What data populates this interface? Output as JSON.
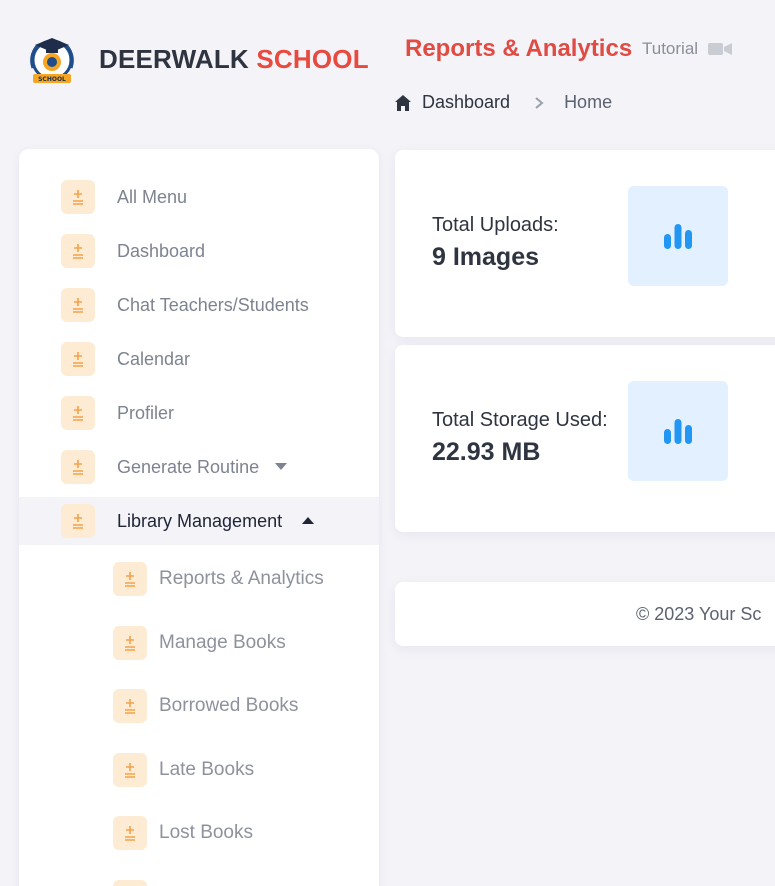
{
  "brand": {
    "part1": "DEERWALK",
    "part2": "SCHOOL",
    "logo_text": "SCHOOL"
  },
  "header": {
    "title": "Reports & Analytics",
    "tutorial_label": "Tutorial",
    "breadcrumb": {
      "dashboard": "Dashboard",
      "home": "Home"
    }
  },
  "sidebar": {
    "items": [
      {
        "label": "All Menu"
      },
      {
        "label": "Dashboard"
      },
      {
        "label": "Chat Teachers/Students"
      },
      {
        "label": "Calendar"
      },
      {
        "label": "Profiler"
      },
      {
        "label": "Generate Routine"
      },
      {
        "label": "Library Management"
      }
    ],
    "library_sub_items": [
      {
        "label": "Reports & Analytics"
      },
      {
        "label": "Manage Books"
      },
      {
        "label": "Borrowed Books"
      },
      {
        "label": "Late Books"
      },
      {
        "label": "Lost Books"
      }
    ]
  },
  "stats": {
    "uploads": {
      "label": "Total Uploads:",
      "value": "9 Images"
    },
    "storage": {
      "label": "Total Storage Used:",
      "value": "22.93 MB"
    }
  },
  "footer": {
    "text": "© 2023  Your Sc"
  },
  "colors": {
    "accent_red": "#e84a3f",
    "icon_bg_orange": "#fdebd4",
    "icon_orange": "#f5a24a",
    "stat_icon_blue": "#2196f3",
    "stat_icon_bg": "#e3f0ff"
  }
}
